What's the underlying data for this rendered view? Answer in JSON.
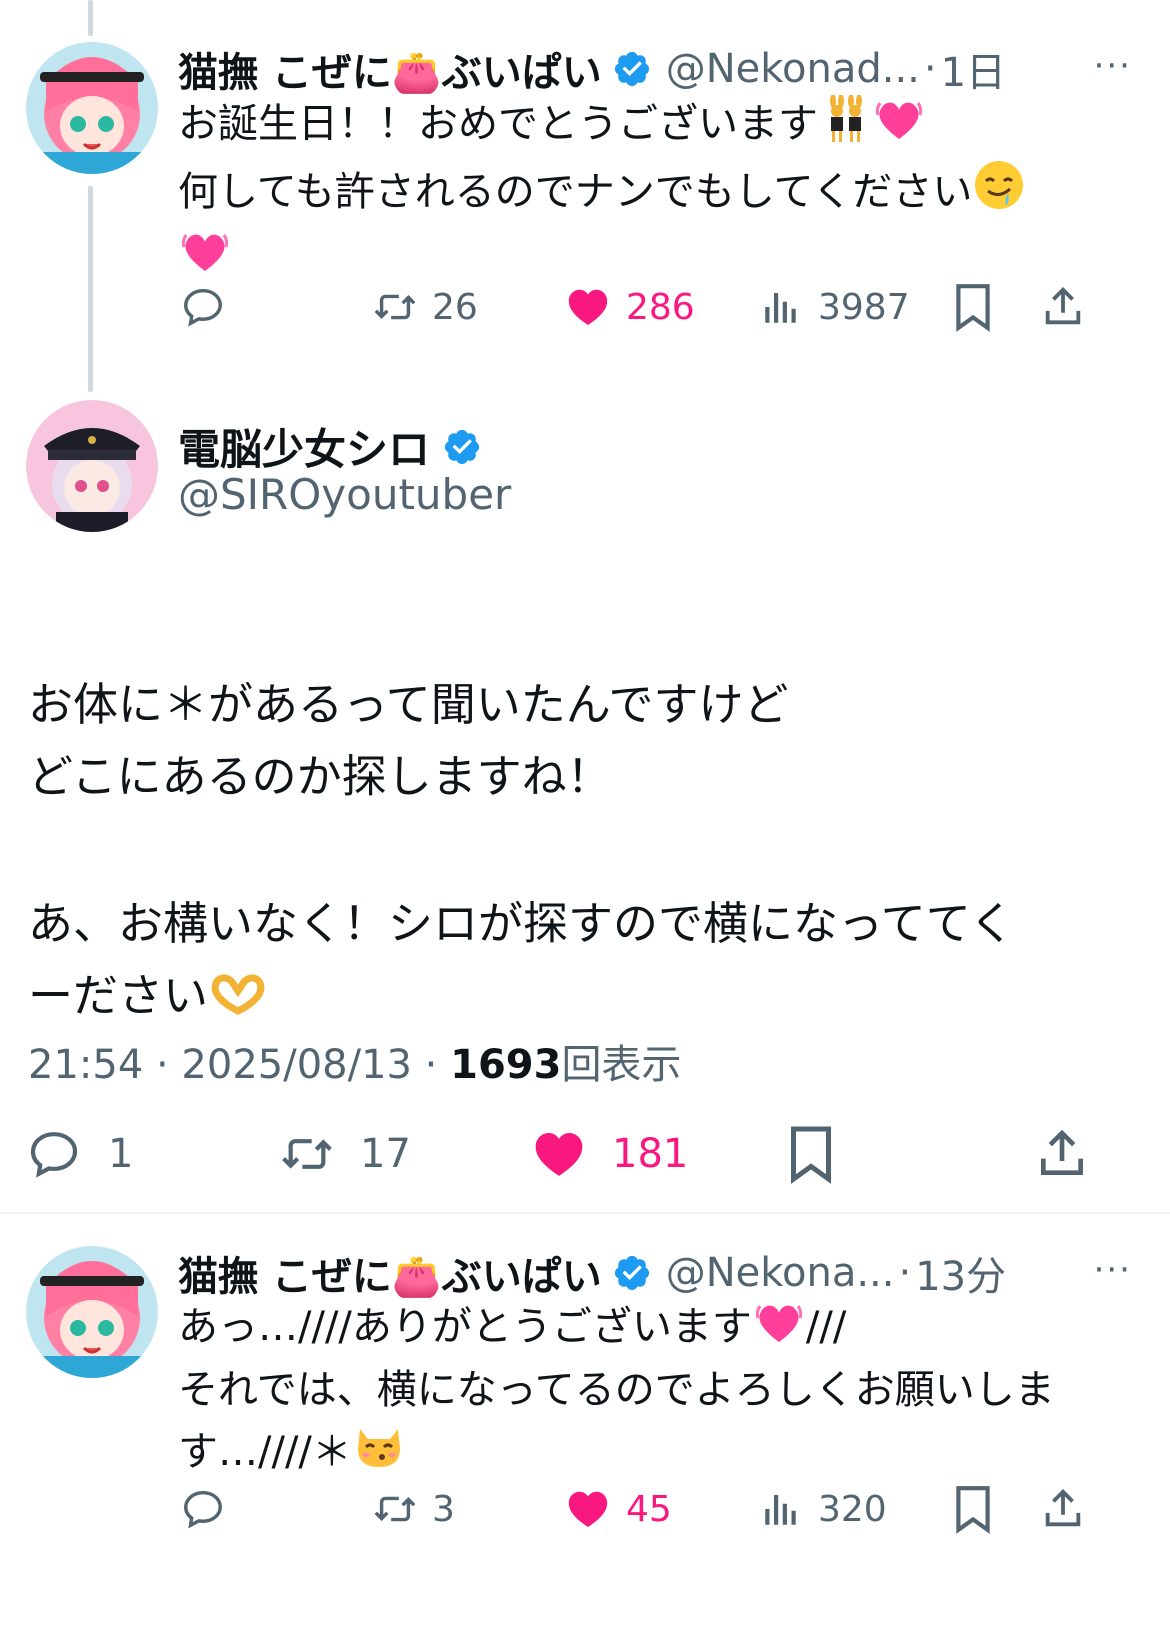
{
  "reply1": {
    "name": "猫撫 こぜに👛ぶいぱい",
    "handle": "@Nekonad...",
    "separator": "·",
    "time": "1日",
    "more": "···",
    "line1": "お誕生日！！おめでとうございます",
    "line2": "何しても許されるのでナンでもしてください",
    "replies": "",
    "reposts": "26",
    "likes": "286",
    "views": "3987"
  },
  "main": {
    "name": "電脳少女シロ",
    "handle": "@SIROyoutuber",
    "text_line1": "お体に＊があるって聞いたんですけど",
    "text_line2": "どこにあるのか探しますね！",
    "text_line3": "あ、お構いなく！シロが探すので横になっててく",
    "text_line4": "ーださい",
    "timestamp": "21:54 · 2025/08/13 · ",
    "view_count": "1693",
    "view_label": "回表示",
    "replies": "1",
    "reposts": "17",
    "likes": "181"
  },
  "reply2": {
    "name": "猫撫 こぜに👛ぶいぱい",
    "handle": "@Nekona...",
    "separator": "·",
    "time": "13分",
    "more": "···",
    "line1": "あっ…////ありがとうございます",
    "line1b": "///",
    "line2": "それでは、横になってるのでよろしくお願いしま",
    "line3": "す…////＊",
    "reposts": "3",
    "likes": "45",
    "views": "320"
  },
  "colors": {
    "accent": "#1d9bf0",
    "like": "#f91880",
    "secondary": "#536471",
    "thread_line": "#cfd9de"
  }
}
